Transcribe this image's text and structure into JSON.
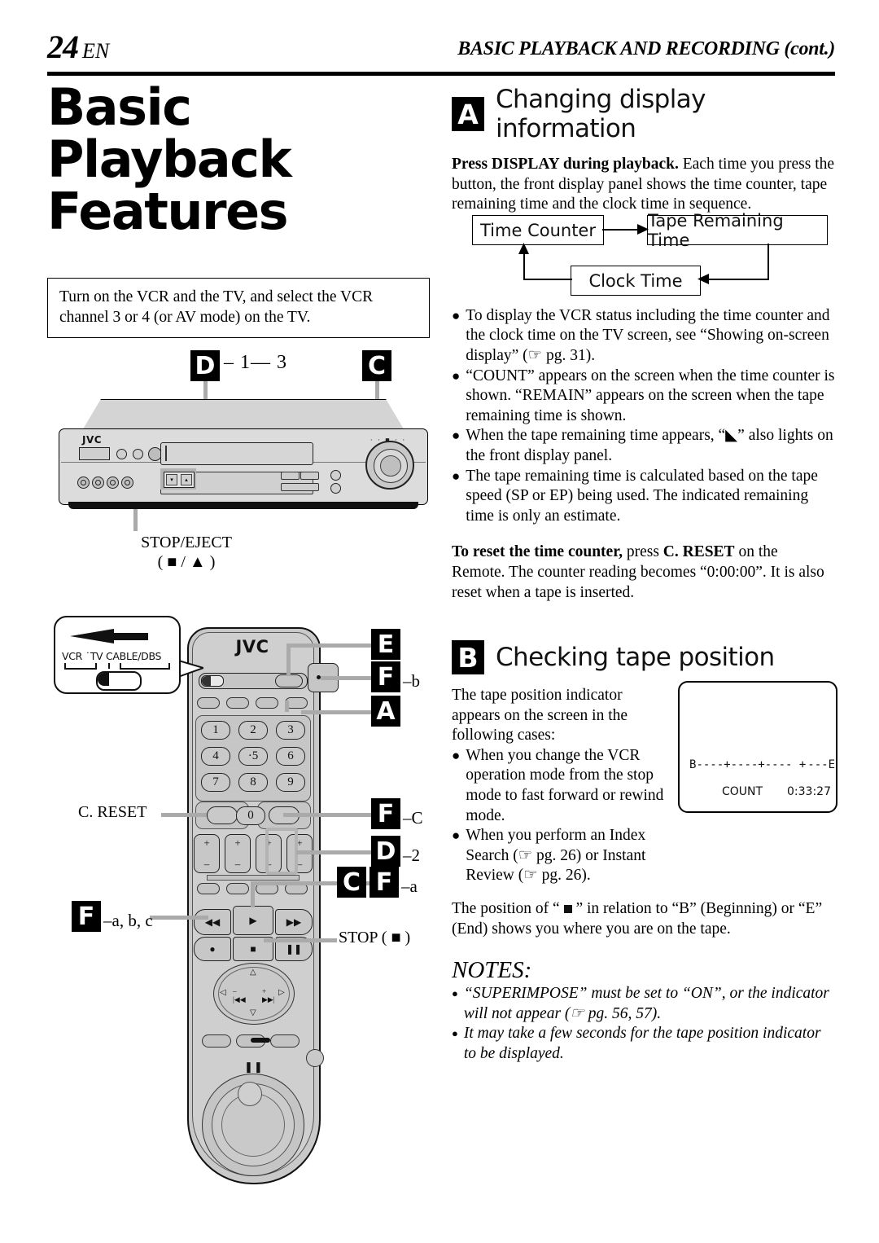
{
  "header": {
    "page_number": "24",
    "lang": "EN",
    "running_title": "BASIC PLAYBACK AND RECORDING (cont.)"
  },
  "left": {
    "title_line1": "Basic",
    "title_line2": "Playback",
    "title_line3": "Features",
    "intro": "Turn on the VCR and the TV, and select the VCR channel 3 or 4 (or AV mode) on the TV.",
    "vcr": {
      "badge_d": "D",
      "badge_d_suffix": "– 1— 3",
      "badge_c": "C",
      "brand": "JVC",
      "stop_eject_label": "STOP/EJECT",
      "stop_eject_symbols": "( ■ / ▲ )"
    },
    "remote": {
      "brand": "JVC",
      "callout": {
        "vcr": "VCR",
        "tv": "TV",
        "cable_dbs": "CABLE/DBS"
      },
      "keys": [
        "1",
        "2",
        "3",
        "4",
        "·5",
        "6",
        "7",
        "8",
        "9",
        "0"
      ],
      "c_reset_label": "C. RESET",
      "stop_label": "STOP ( ■ )",
      "badge_e": "E",
      "badge_f_b": "F",
      "badge_f_b_suffix": "–b",
      "badge_a": "A",
      "badge_f_c": "F",
      "badge_f_c_suffix": "–C",
      "badge_d_2": "D",
      "badge_d_2_suffix": "–2",
      "badge_c": "C",
      "badge_f_a": "F",
      "badge_f_a_suffix": "–a",
      "badge_f_abc": "F",
      "badge_f_abc_suffix": "–a, b, c"
    }
  },
  "right": {
    "section_a": {
      "badge": "A",
      "title": "Changing display information",
      "lead_bold": "Press DISPLAY during playback.",
      "lead_body": "Each time you press the button, the front display panel shows the time counter, tape remaining time and the clock time in sequence.",
      "flow": {
        "box1": "Time Counter",
        "box2": "Tape Remaining Time",
        "box3": "Clock Time"
      },
      "bullets": [
        "To display the VCR status including the time counter and the clock time on the TV screen, see “Showing on-screen display”  (☞ pg. 31).",
        "“COUNT” appears on the screen when the time counter is shown. “REMAIN” appears on the screen when the tape remaining time is shown.",
        "When the tape remaining time appears, “◣” also lights on the front display panel.",
        "The tape remaining time is calculated based on the tape speed (SP or EP) being used. The indicated remaining time is only an estimate."
      ],
      "reset_bold": "To reset the time counter,",
      "reset_rest_1": " press ",
      "reset_bold_2": "C. RESET",
      "reset_rest_2": " on the Remote. The counter reading becomes “0:00:00”. It is also reset when a tape is inserted."
    },
    "section_b": {
      "badge": "B",
      "title": "Checking tape position",
      "lead": "The tape position indicator appears on the screen in the following cases:",
      "bullets": [
        "When you change the VCR operation mode from the stop mode to fast forward or rewind mode.",
        "When you perform an Index Search (☞ pg. 26) or Instant Review (☞ pg. 26)."
      ],
      "tv_screen": {
        "begin_mark": "B",
        "end_mark": "E",
        "track": "----+----+----  +",
        "track_after": "---",
        "count_label": "COUNT",
        "count_value": "0:33:27"
      },
      "position_text_1": "The position of “ ",
      "position_text_2": " ” in relation to “B” (Beginning) or “E” (End) shows you where you are on the tape.",
      "notes_heading": "NOTES:",
      "notes": [
        "“SUPERIMPOSE” must be set to “ON”, or the indicator will not appear (☞ pg. 56, 57).",
        "It may take a few seconds for the tape position indicator to be displayed."
      ]
    }
  }
}
